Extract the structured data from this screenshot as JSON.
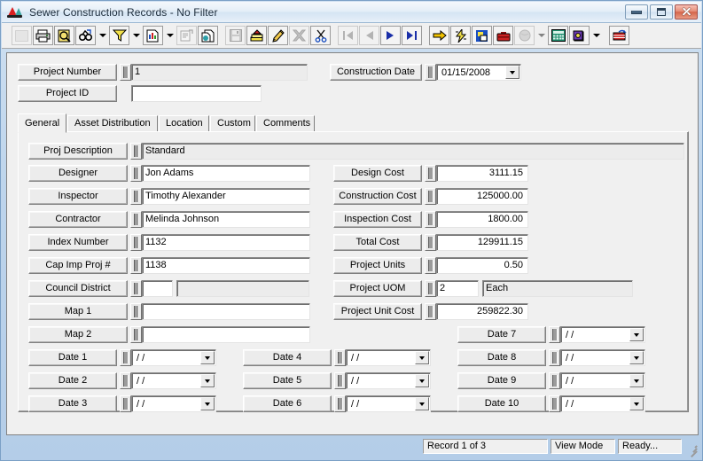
{
  "window": {
    "title": "Sewer Construction Records - No Filter",
    "app_icon": "sewer-app-icon",
    "controls": {
      "minimize": "minimize",
      "maximize": "maximize",
      "close": "close"
    }
  },
  "toolbar": {
    "groups": [
      [
        {
          "name": "select-tool-icon",
          "glyph": "▦",
          "disabled": true
        },
        {
          "name": "print-icon",
          "glyph": "printer",
          "disabled": false
        },
        {
          "name": "print-preview-icon",
          "glyph": "preview",
          "disabled": false
        },
        {
          "name": "find-icon",
          "glyph": "binoculars",
          "disabled": false
        },
        {
          "name": "find-dropdown-icon",
          "glyph": "caret",
          "disabled": false
        },
        {
          "name": "filter-icon",
          "glyph": "funnel",
          "disabled": false
        },
        {
          "name": "filter-dropdown-icon",
          "glyph": "caret",
          "disabled": false
        },
        {
          "name": "report-icon",
          "glyph": "report",
          "disabled": false
        },
        {
          "name": "report-dropdown-icon",
          "glyph": "caret",
          "disabled": false
        },
        {
          "name": "properties-icon",
          "glyph": "properties",
          "disabled": true
        },
        {
          "name": "duplicate-record-icon",
          "glyph": "duplicate",
          "disabled": false
        }
      ],
      [
        {
          "name": "save-icon",
          "glyph": "floppy",
          "disabled": true
        },
        {
          "name": "post-record-icon",
          "glyph": "books",
          "disabled": false
        },
        {
          "name": "edit-icon",
          "glyph": "pencil",
          "disabled": false
        },
        {
          "name": "delete-icon",
          "glyph": "x-mark",
          "disabled": true
        },
        {
          "name": "cut-icon",
          "glyph": "scissors",
          "disabled": false
        }
      ],
      [
        {
          "name": "first-record-icon",
          "glyph": "first",
          "disabled": true
        },
        {
          "name": "previous-record-icon",
          "glyph": "prev",
          "disabled": true
        },
        {
          "name": "next-record-icon",
          "glyph": "next",
          "disabled": false
        },
        {
          "name": "last-record-icon",
          "glyph": "last",
          "disabled": false
        }
      ],
      [
        {
          "name": "goto-icon",
          "glyph": "yellow-arrow",
          "disabled": false
        },
        {
          "name": "quick-action-icon",
          "glyph": "lightning",
          "disabled": false
        },
        {
          "name": "layout-icon",
          "glyph": "layout",
          "disabled": false
        },
        {
          "name": "toolbox-icon",
          "glyph": "toolbox",
          "disabled": false
        },
        {
          "name": "attachment-icon",
          "glyph": "sphere",
          "disabled": true
        },
        {
          "name": "attachment-dropdown-icon",
          "glyph": "caret",
          "disabled": true
        },
        {
          "name": "calculator-icon",
          "glyph": "calculator",
          "disabled": false
        },
        {
          "name": "help-book-icon",
          "glyph": "book",
          "disabled": false
        },
        {
          "name": "help-dropdown-icon",
          "glyph": "caret",
          "disabled": false
        }
      ],
      [
        {
          "name": "export-icon",
          "glyph": "export",
          "disabled": false
        }
      ]
    ]
  },
  "header": {
    "project_number": {
      "label": "Project Number",
      "value": "1"
    },
    "project_id": {
      "label": "Project ID",
      "value": ""
    },
    "construction_date": {
      "label": "Construction Date",
      "value": "01/15/2008"
    }
  },
  "tabs": [
    {
      "label": "General",
      "active": true
    },
    {
      "label": "Asset Distribution",
      "active": false
    },
    {
      "label": "Location",
      "active": false
    },
    {
      "label": "Custom",
      "active": false
    },
    {
      "label": "Comments",
      "active": false
    }
  ],
  "general": {
    "description": {
      "label": "Proj Description",
      "value": "Standard"
    },
    "left_fields": [
      {
        "label": "Designer",
        "value": "Jon Adams"
      },
      {
        "label": "Inspector",
        "value": "Timothy Alexander"
      },
      {
        "label": "Contractor",
        "value": "Melinda Johnson"
      },
      {
        "label": "Index Number",
        "value": "1132"
      },
      {
        "label": "Cap Imp Proj #",
        "value": "1138"
      }
    ],
    "council_district": {
      "label": "Council District",
      "code": "",
      "description": ""
    },
    "maps": [
      {
        "label": "Map 1",
        "value": ""
      },
      {
        "label": "Map 2",
        "value": ""
      }
    ],
    "right_fields": [
      {
        "label": "Design Cost",
        "value": "3111.15"
      },
      {
        "label": "Construction Cost",
        "value": "125000.00"
      },
      {
        "label": "Inspection Cost",
        "value": "1800.00"
      },
      {
        "label": "Total Cost",
        "value": "129911.15"
      },
      {
        "label": "Project Units",
        "value": "0.50"
      }
    ],
    "project_uom": {
      "label": "Project UOM",
      "code": "2",
      "description": "Each"
    },
    "project_unit_cost": {
      "label": "Project Unit Cost",
      "value": "259822.30"
    },
    "dates_col1": [
      {
        "label": "Date 1",
        "value": "/  /"
      },
      {
        "label": "Date 2",
        "value": "/  /"
      },
      {
        "label": "Date 3",
        "value": "/  /"
      }
    ],
    "dates_col2": [
      {
        "label": "Date 4",
        "value": "/  /"
      },
      {
        "label": "Date 5",
        "value": "/  /"
      },
      {
        "label": "Date 6",
        "value": "/  /"
      }
    ],
    "dates_col3": [
      {
        "label": "Date 7",
        "value": "/  /"
      },
      {
        "label": "Date 8",
        "value": "/  /"
      },
      {
        "label": "Date 9",
        "value": "/  /"
      },
      {
        "label": "Date 10",
        "value": "/  /"
      }
    ]
  },
  "statusbar": {
    "record": "Record 1 of 3",
    "mode": "View Mode",
    "state": "Ready..."
  },
  "colors": {
    "window_frame": "#b9d3ea",
    "face": "#f0f0f0",
    "field_bg": "#ffffff",
    "readonly_bg": "#ececec",
    "close_button": "#d4654a"
  }
}
